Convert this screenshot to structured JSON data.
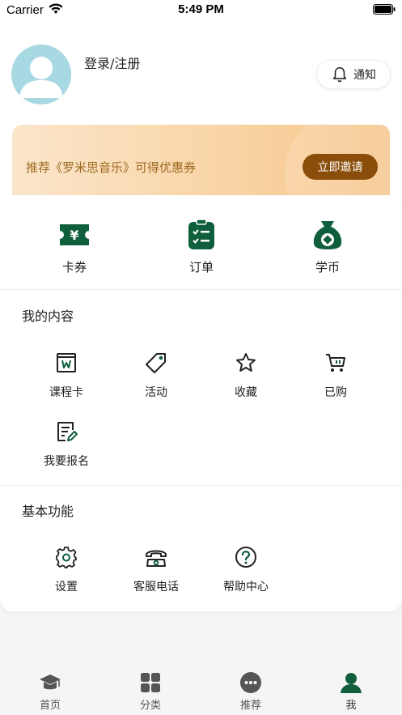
{
  "status_bar": {
    "carrier": "Carrier",
    "time": "5:49 PM"
  },
  "profile": {
    "login_label": "登录/注册",
    "notify_label": "通知"
  },
  "promo": {
    "text": "推荐《罗米思音乐》可得优惠券",
    "button_label": "立即邀请",
    "button_color": "#8a4e0a"
  },
  "quick_actions": [
    {
      "label": "卡券",
      "icon": "ticket-icon"
    },
    {
      "label": "订单",
      "icon": "clipboard-icon"
    },
    {
      "label": "学币",
      "icon": "money-bag-icon"
    }
  ],
  "my_content": {
    "title": "我的内容",
    "items": [
      {
        "label": "课程卡",
        "icon": "course-card-icon"
      },
      {
        "label": "活动",
        "icon": "tag-icon"
      },
      {
        "label": "收藏",
        "icon": "star-icon"
      },
      {
        "label": "已购",
        "icon": "cart-icon"
      },
      {
        "label": "我要报名",
        "icon": "edit-form-icon"
      }
    ]
  },
  "basic_functions": {
    "title": "基本功能",
    "items": [
      {
        "label": "设置",
        "icon": "gear-icon"
      },
      {
        "label": "客服电话",
        "icon": "phone-icon"
      },
      {
        "label": "帮助中心",
        "icon": "help-icon"
      }
    ]
  },
  "tab_bar": {
    "active": "我",
    "items": [
      {
        "label": "首页",
        "icon": "graduation-cap-icon"
      },
      {
        "label": "分类",
        "icon": "grid-icon"
      },
      {
        "label": "推荐",
        "icon": "chat-bubble-icon"
      },
      {
        "label": "我",
        "icon": "user-icon"
      }
    ]
  },
  "colors": {
    "accent_green": "#0f5e3c",
    "avatar_bg": "#a8d8e2"
  }
}
